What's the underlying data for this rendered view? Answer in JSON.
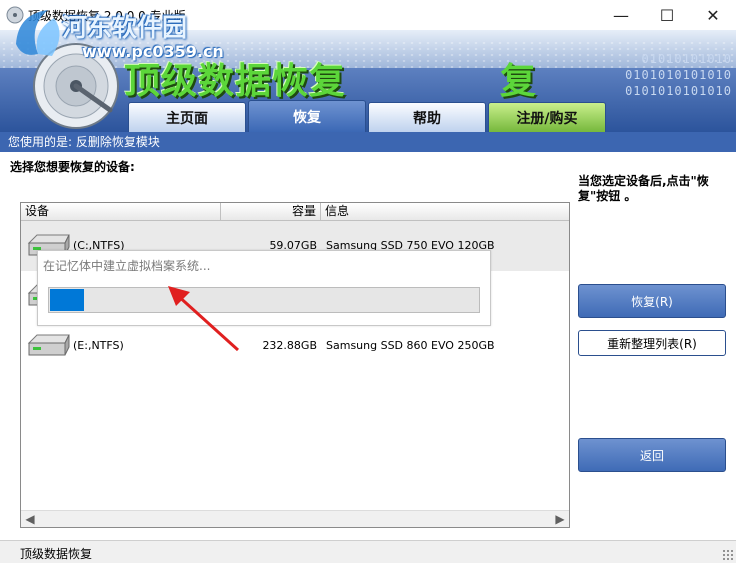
{
  "window": {
    "title": "顶级数据恢复 2.0.0.0 专业版",
    "minimize_glyph": "—",
    "maximize_glyph": "☐",
    "close_glyph": "✕"
  },
  "watermark": {
    "site_name": "河东软件园",
    "url": "www.pc0359.cn"
  },
  "banner": {
    "title": "顶级数据恢复",
    "title_fragment": "复",
    "binary_lines": [
      "01010101010",
      "0101010101010",
      "0101010101010"
    ]
  },
  "tabs": [
    {
      "label": "主页面",
      "active": false
    },
    {
      "label": "恢复",
      "active": true
    },
    {
      "label": "帮助",
      "active": false
    },
    {
      "label": "注册/购买",
      "active": false
    }
  ],
  "mode_text": "您使用的是: 反删除恢复模块",
  "main": {
    "prompt": "选择您想要恢复的设备:",
    "hint": "当您选定设备后,点击\"恢复\"按钮 。"
  },
  "device_list": {
    "columns": [
      "设备",
      "容量",
      "信息"
    ],
    "rows": [
      {
        "device": "(C:,NTFS)",
        "capacity": "59.07GB",
        "info": "Samsung SSD 750 EVO 120GB",
        "selected": true
      },
      {
        "device": "",
        "capacity": "",
        "info": "",
        "selected": false
      },
      {
        "device": "(E:,NTFS)",
        "capacity": "232.88GB",
        "info": "Samsung SSD 860 EVO 250GB",
        "selected": false
      }
    ]
  },
  "progress_popup": {
    "message": "在记忆体中建立虚拟档案系统...",
    "progress": 0.08
  },
  "buttons": {
    "recover": "恢复(R)",
    "reorder": "重新整理列表(R)",
    "back": "返回"
  },
  "status_text": "顶级数据恢复",
  "colors": {
    "accent_blue": "#3c66b1",
    "progress_blue": "#0078d7",
    "title_green": "#5cd63a",
    "arrow_red": "#e02020"
  },
  "icons": {
    "app": "disk-app-icon",
    "drive": "hard-drive-icon",
    "arrow": "red-arrow-annotation"
  }
}
